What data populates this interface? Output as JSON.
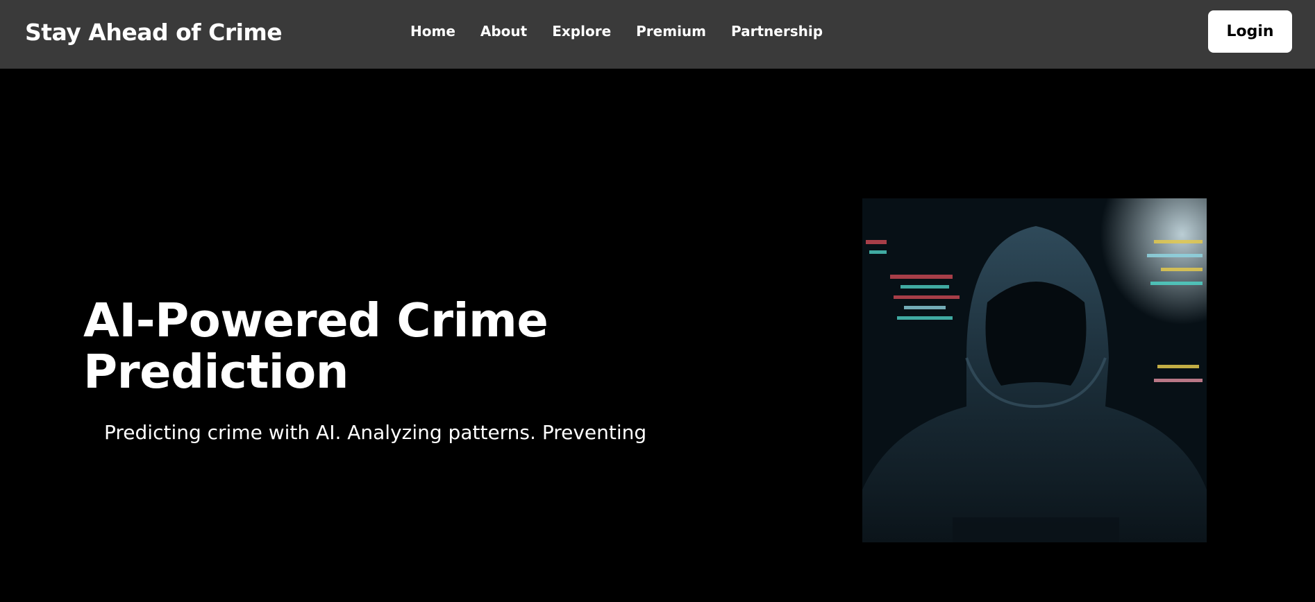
{
  "navbar": {
    "brand": "Stay Ahead of Crime",
    "links": [
      {
        "label": "Home"
      },
      {
        "label": "About"
      },
      {
        "label": "Explore"
      },
      {
        "label": "Premium"
      },
      {
        "label": "Partnership"
      }
    ],
    "login_label": "Login"
  },
  "hero": {
    "title": "AI-Powered Crime Prediction",
    "subtitle": "Predicting crime with AI. Analyzing patterns. Preventing",
    "image_icon": "hooded-figure-image"
  },
  "colors": {
    "navbar_bg": "#3a3a3a",
    "page_bg": "#000000",
    "text": "#ffffff",
    "button_bg": "#ffffff"
  }
}
